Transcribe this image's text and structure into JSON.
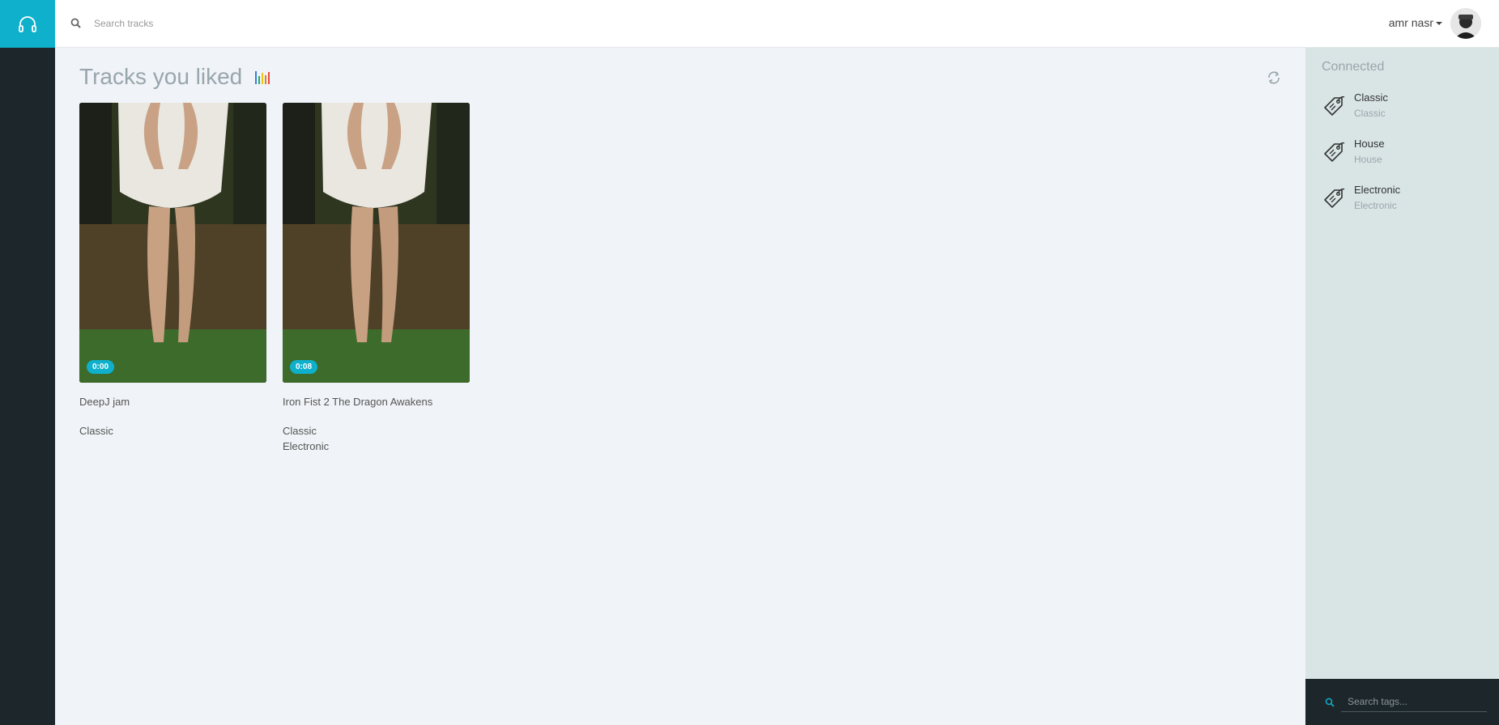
{
  "header": {
    "search_placeholder": "Search tracks",
    "user_name": "amr nasr"
  },
  "main": {
    "title": "Tracks you liked",
    "tracks": [
      {
        "title": "DeepJ jam",
        "time": "0:00",
        "tags": [
          "Classic"
        ]
      },
      {
        "title": "Iron Fist 2 The Dragon Awakens",
        "time": "0:08",
        "tags": [
          "Classic",
          "Electronic"
        ]
      }
    ]
  },
  "right_panel": {
    "title": "Connected",
    "tags": [
      {
        "name": "Classic",
        "sub": "Classic"
      },
      {
        "name": "House",
        "sub": "House"
      },
      {
        "name": "Electronic",
        "sub": "Electronic"
      }
    ],
    "search_placeholder": "Search tags..."
  },
  "colors": {
    "accent": "#0fb0cc",
    "sidebar": "#1d272b",
    "right_panel_bg": "#d9e5e5",
    "main_bg": "#f0f3f7"
  },
  "icons": {
    "logo": "headphones-icon",
    "search": "search-icon",
    "title_badge": "equalizer-icon",
    "refresh": "refresh-icon",
    "tag": "tag-icon"
  }
}
